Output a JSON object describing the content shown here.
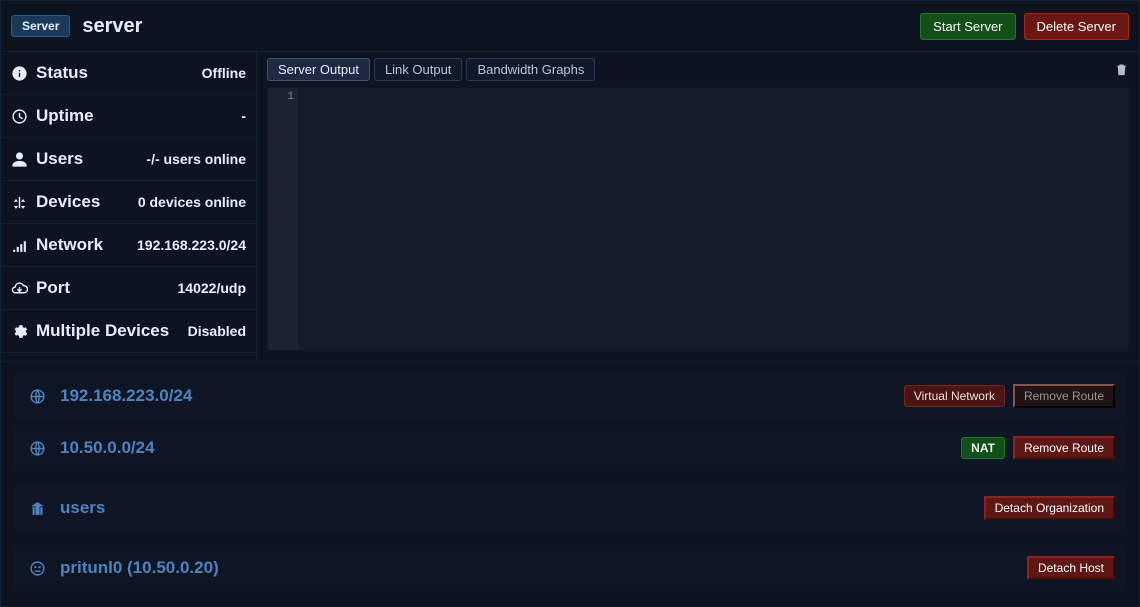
{
  "header": {
    "chip": "Server",
    "title": "server",
    "start_label": "Start Server",
    "delete_label": "Delete Server"
  },
  "sidebar": {
    "status": {
      "label": "Status",
      "value": "Offline"
    },
    "uptime": {
      "label": "Uptime",
      "value": "-"
    },
    "users": {
      "label": "Users",
      "value": "-/- users online"
    },
    "devices": {
      "label": "Devices",
      "value": "0 devices online"
    },
    "network": {
      "label": "Network",
      "value": "192.168.223.0/24"
    },
    "port": {
      "label": "Port",
      "value": "14022/udp"
    },
    "multi": {
      "label": "Multiple Devices",
      "value": "Disabled"
    }
  },
  "tabs": {
    "server_output": "Server Output",
    "link_output": "Link Output",
    "bandwidth_graphs": "Bandwidth Graphs"
  },
  "console": {
    "gutter_1": "1"
  },
  "routes": [
    {
      "cidr": "192.168.223.0/24",
      "badge": "Virtual Network",
      "remove_label": "Remove Route",
      "remove_enabled": false
    },
    {
      "cidr": "10.50.0.0/24",
      "badge": "NAT",
      "remove_label": "Remove Route",
      "remove_enabled": true
    }
  ],
  "org": {
    "name": "users",
    "detach_label": "Detach Organization"
  },
  "host": {
    "name": "pritunl0 (10.50.0.20)",
    "detach_label": "Detach Host"
  }
}
